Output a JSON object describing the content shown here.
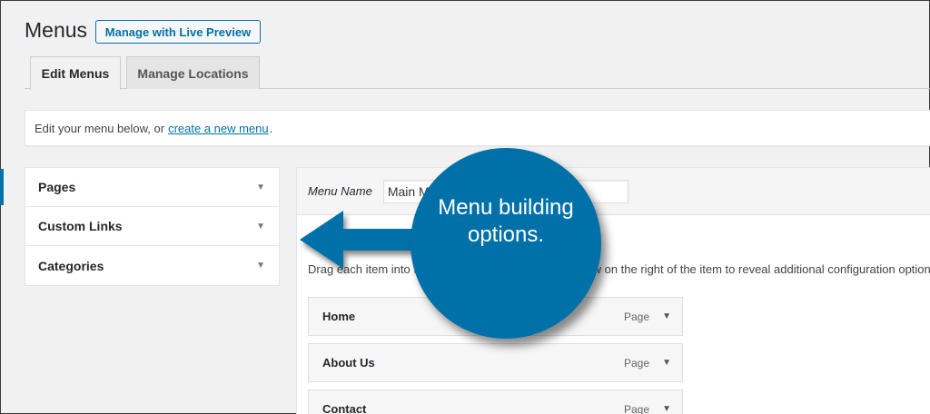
{
  "header": {
    "title": "Menus",
    "live_preview_label": "Manage with Live Preview"
  },
  "tabs": [
    {
      "label": "Edit Menus",
      "active": true
    },
    {
      "label": "Manage Locations",
      "active": false
    }
  ],
  "notice": {
    "text_before": "Edit your menu below, or",
    "link_text": "create a new menu",
    "text_after": "."
  },
  "sidebar": {
    "items": [
      {
        "label": "Pages"
      },
      {
        "label": "Custom Links"
      },
      {
        "label": "Categories"
      }
    ]
  },
  "menu_editor": {
    "menu_name_label": "Menu Name",
    "menu_name_value": "Main Menu",
    "instructions": "Drag each item into the order you prefer. Click the arrow on the right of the item to reveal additional configuration options.",
    "items": [
      {
        "title": "Home",
        "type": "Page"
      },
      {
        "title": "About Us",
        "type": "Page"
      },
      {
        "title": "Contact",
        "type": "Page"
      }
    ]
  },
  "annotation": {
    "text": "Menu building options."
  },
  "colors": {
    "accent": "#0073aa",
    "bubble": "#0071a8"
  }
}
